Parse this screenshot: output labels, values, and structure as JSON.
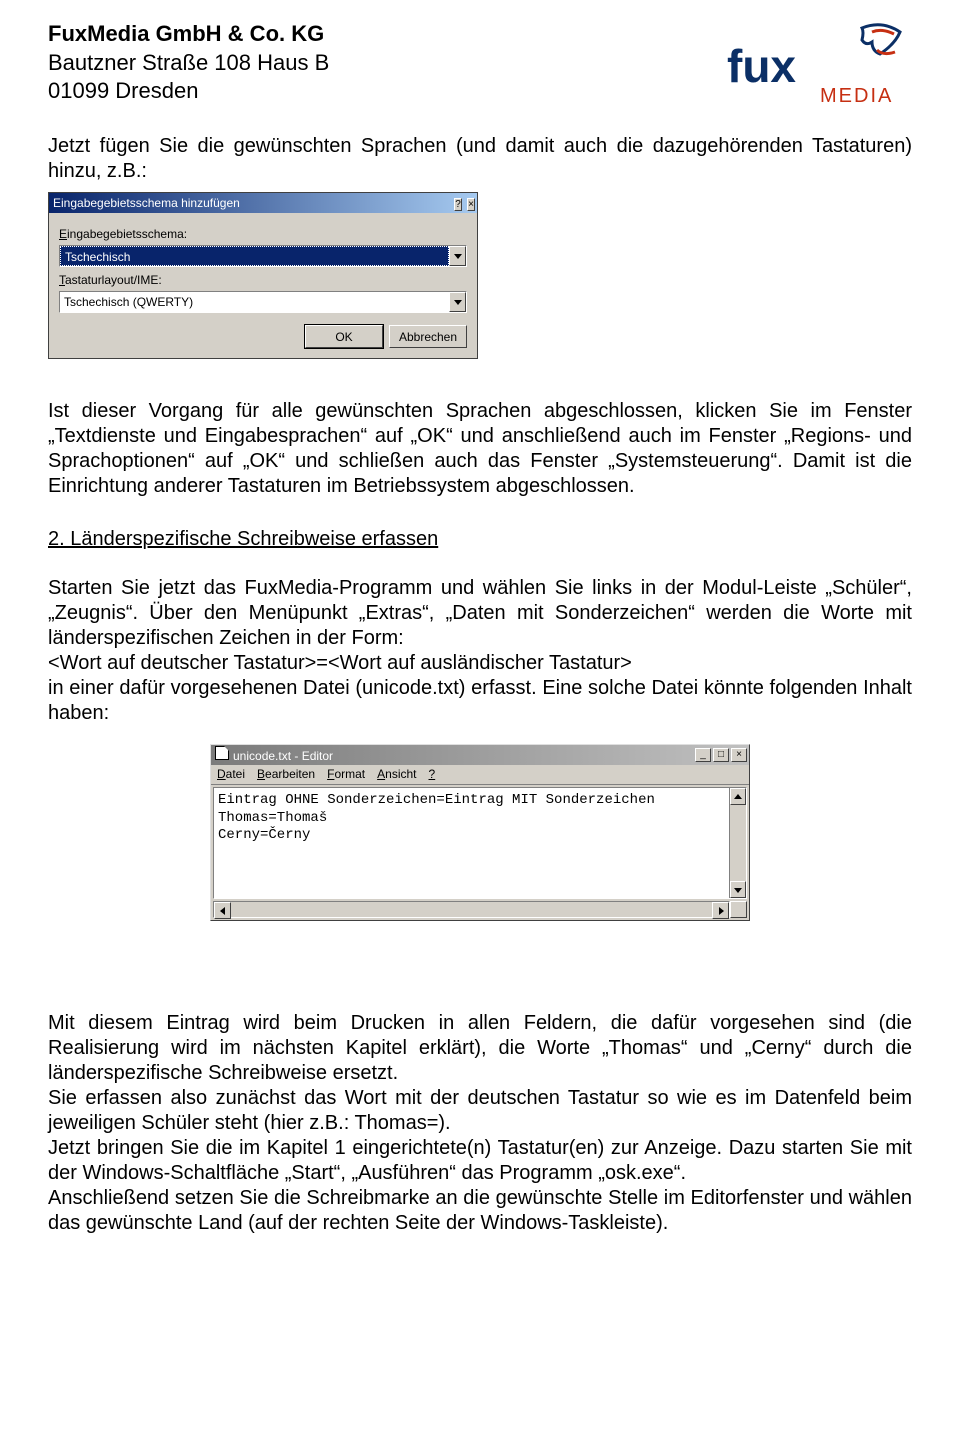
{
  "header": {
    "company": "FuxMedia GmbH & Co. KG",
    "street": "Bautzner Straße 108 Haus B",
    "city": "01099 Dresden",
    "logo_text_top": "fux",
    "logo_text_bottom": "MEDIA"
  },
  "intro": "Jetzt fügen Sie die gewünschten Sprachen (und damit auch die dazugehörenden Tastaturen) hinzu, z.B.:",
  "dialog1": {
    "title": "Eingabegebietsschema hinzufügen",
    "label1_pre": "E",
    "label1_rest": "ingabegebietsschema:",
    "combo1_value": "Tschechisch",
    "label2_pre": "T",
    "label2_rest": "astaturlayout/IME:",
    "combo2_value": "Tschechisch (QWERTY)",
    "ok": "OK",
    "cancel": "Abbrechen",
    "help_icon": "?",
    "close_icon": "×"
  },
  "after_dialog": "Ist dieser Vorgang für alle gewünschten Sprachen abgeschlossen, klicken Sie im Fenster „Textdienste und Eingabesprachen“ auf „OK“ und anschließend auch im Fenster „Regions- und Sprachoptionen“ auf „OK“ und schließen auch das Fenster „Systemsteuerung“. Damit ist die Einrichtung anderer Tastaturen im Betriebssystem abgeschlossen.",
  "section2_title": "2. Länderspezifische Schreibweise erfassen",
  "section2_body": "Starten Sie jetzt das FuxMedia-Programm und wählen Sie links in der Modul-Leiste „Schüler“, „Zeugnis“. Über den Menüpunkt „Extras“, „Daten mit Sonderzeichen“ werden die Worte mit länderspezifischen Zeichen in der Form:\n<Wort auf deutscher Tastatur>=<Wort auf ausländischer Tastatur>\nin einer dafür vorgesehenen Datei (unicode.txt) erfasst. Eine solche Datei könnte folgenden Inhalt haben:",
  "editor": {
    "title": "unicode.txt - Editor",
    "menu": [
      {
        "ul": "D",
        "rest": "atei"
      },
      {
        "ul": "B",
        "rest": "earbeiten"
      },
      {
        "ul": "F",
        "rest": "ormat"
      },
      {
        "ul": "A",
        "rest": "nsicht"
      },
      {
        "ul": "?",
        "rest": ""
      }
    ],
    "content": "Eintrag OHNE Sonderzeichen=Eintrag MIT Sonderzeichen\nThomas=Thomaš\nCerny=Černy",
    "min_icon": "_",
    "max_icon": "□",
    "close_icon": "×"
  },
  "final_para": "Mit diesem Eintrag wird beim Drucken in allen Feldern, die dafür vorgesehen sind (die Realisierung wird im nächsten Kapitel erklärt), die Worte „Thomas“ und „Cerny“ durch die länderspezifische Schreibweise ersetzt.\nSie erfassen also zunächst das Wort mit der deutschen Tastatur so wie es im Datenfeld beim jeweiligen Schüler steht (hier z.B.: Thomas=).\nJetzt bringen Sie die im Kapitel 1 eingerichtete(n) Tastatur(en) zur Anzeige. Dazu starten Sie mit der Windows-Schaltfläche „Start“, „Ausführen“ das Programm „osk.exe“.\nAnschließend setzen Sie die Schreibmarke an die gewünschte Stelle im Editorfenster und wählen das gewünschte Land (auf der rechten Seite der Windows-Taskleiste)."
}
